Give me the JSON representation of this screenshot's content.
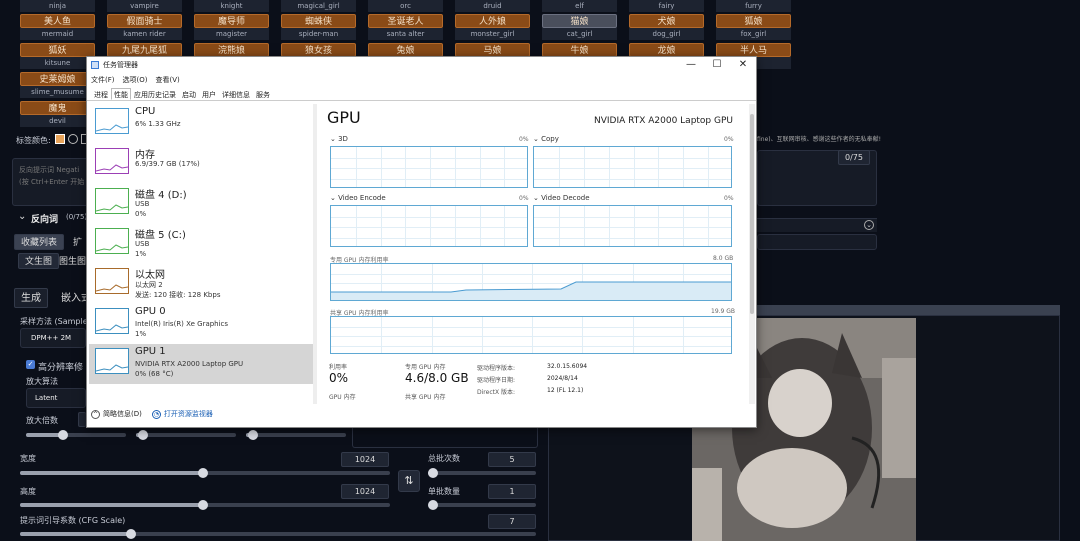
{
  "webui": {
    "tags_row0_en": [
      "ninja",
      "vampire",
      "knight",
      "magical_girl",
      "orc",
      "druid",
      "elf",
      "fairy",
      "furry"
    ],
    "tags_row1": [
      {
        "zh": "美人鱼",
        "en": "mermaid"
      },
      {
        "zh": "假面骑士",
        "en": "kamen rider"
      },
      {
        "zh": "魔导师",
        "en": "magister"
      },
      {
        "zh": "蜘蛛侠",
        "en": "spider-man"
      },
      {
        "zh": "圣诞老人",
        "en": "santa alter"
      },
      {
        "zh": "人外娘",
        "en": "monster_girl"
      },
      {
        "zh": "猫娘",
        "en": "cat_girl"
      },
      {
        "zh": "犬娘",
        "en": "dog_girl"
      },
      {
        "zh": "狐娘",
        "en": "fox_girl"
      }
    ],
    "tags_row2": [
      {
        "zh": "狐妖",
        "en": "kitsune"
      },
      {
        "zh": "九尾九尾狐",
        "en": ""
      },
      {
        "zh": "浣熊娘",
        "en": ""
      },
      {
        "zh": "狼女孩",
        "en": ""
      },
      {
        "zh": "兔娘",
        "en": ""
      },
      {
        "zh": "马娘",
        "en": ""
      },
      {
        "zh": "牛娘",
        "en": ""
      },
      {
        "zh": "龙娘",
        "en": ""
      },
      {
        "zh": "半人马",
        "en": ""
      }
    ],
    "tags_row3": [
      {
        "zh": "史莱姆娘",
        "en": "slime_musume"
      }
    ],
    "tags_row4": [
      {
        "zh": "魔鬼",
        "en": "devil"
      }
    ],
    "tag_color_label": "标签颜色:",
    "negative_placeholder": "反向提示词 Negati",
    "negative_hint": "(按 Ctrl+Enter 开始",
    "negative_section": "反向词",
    "negative_count": "(0/75)",
    "token_count": "0/75",
    "right_hint": "fine)、互联网审核、感谢这些作者的无私奉献!",
    "tab_fav": "收藏列表",
    "tab_ext": "扩",
    "subtab_txt": "文生图",
    "subtab_img": "图生图",
    "tab_generate": "生成",
    "tab_embed": "嵌入式",
    "sampler_label": "采样方法 (Sampler",
    "sampler_value": "DPM++ 2M",
    "hires_label": "高分辨率修",
    "upscaler_label": "放大算法",
    "upscaler_value": "Latent",
    "upscale_by_label": "放大倍数",
    "width_label": "宽度",
    "width_value": "1024",
    "height_label": "高度",
    "height_value": "1024",
    "batch_count_label": "总批次数",
    "batch_count_value": "5",
    "batch_size_label": "单批数量",
    "batch_size_value": "1",
    "cfg_label": "提示词引导系数 (CFG Scale)",
    "cfg_value": "7",
    "swap_icon": "⇅"
  },
  "taskmgr": {
    "title": "任务管理器",
    "menu": [
      "文件(F)",
      "选项(O)",
      "查看(V)"
    ],
    "tabs": [
      "进程",
      "性能",
      "应用历史记录",
      "启动",
      "用户",
      "详细信息",
      "服务"
    ],
    "active_tab": 1,
    "sidebar": [
      {
        "name": "CPU",
        "sub1": "6% 1.33 GHz",
        "sub2": "",
        "color": "#4a9bd1"
      },
      {
        "name": "内存",
        "sub1": "6.9/39.7 GB (17%)",
        "sub2": "",
        "color": "#9b3fb5"
      },
      {
        "name": "磁盘 4 (D:)",
        "sub1": "USB",
        "sub2": "0%",
        "color": "#4caf50"
      },
      {
        "name": "磁盘 5 (C:)",
        "sub1": "USB",
        "sub2": "1%",
        "color": "#4caf50"
      },
      {
        "name": "以太网",
        "sub1": "以太网 2",
        "sub2": "发送: 120  接收: 128 Kbps",
        "color": "#a86b2b"
      },
      {
        "name": "GPU 0",
        "sub1": "Intel(R) Iris(R) Xe Graphics",
        "sub2": "1%",
        "color": "#3c8fbf"
      },
      {
        "name": "GPU 1",
        "sub1": "NVIDIA RTX A2000 Laptop GPU",
        "sub2": "0% (68 °C)",
        "color": "#3c8fbf"
      }
    ],
    "selected_index": 6,
    "main": {
      "title": "GPU",
      "gpu_name": "NVIDIA RTX A2000 Laptop GPU",
      "graphs": [
        {
          "label": "3D",
          "pct": "0%"
        },
        {
          "label": "Copy",
          "pct": "0%"
        },
        {
          "label": "Video Encode",
          "pct": "0%"
        },
        {
          "label": "Video Decode",
          "pct": "0%"
        }
      ],
      "dedicated_label": "专用 GPU 内存利用率",
      "dedicated_max": "8.0 GB",
      "shared_label": "共享 GPU 内存利用率",
      "shared_max": "19.9 GB",
      "util_label": "利用率",
      "util_value": "0%",
      "ded_mem_label": "专用 GPU 内存",
      "ded_mem_value": "4.6/8.0 GB",
      "gpu_mem_label": "GPU 内存",
      "shared_mem_label": "共享 GPU 内存",
      "driver_version_label": "驱动程序版本:",
      "driver_version_value": "32.0.15.6094",
      "driver_date_label": "驱动程序日期:",
      "driver_date_value": "2024/8/14",
      "directx_label": "DirectX 版本:",
      "directx_value": "12 (FL 12.1)"
    },
    "footer_summary": "简略信息(D)",
    "footer_link": "打开资源监视器",
    "win_min": "—",
    "win_max": "☐",
    "win_close": "✕"
  }
}
